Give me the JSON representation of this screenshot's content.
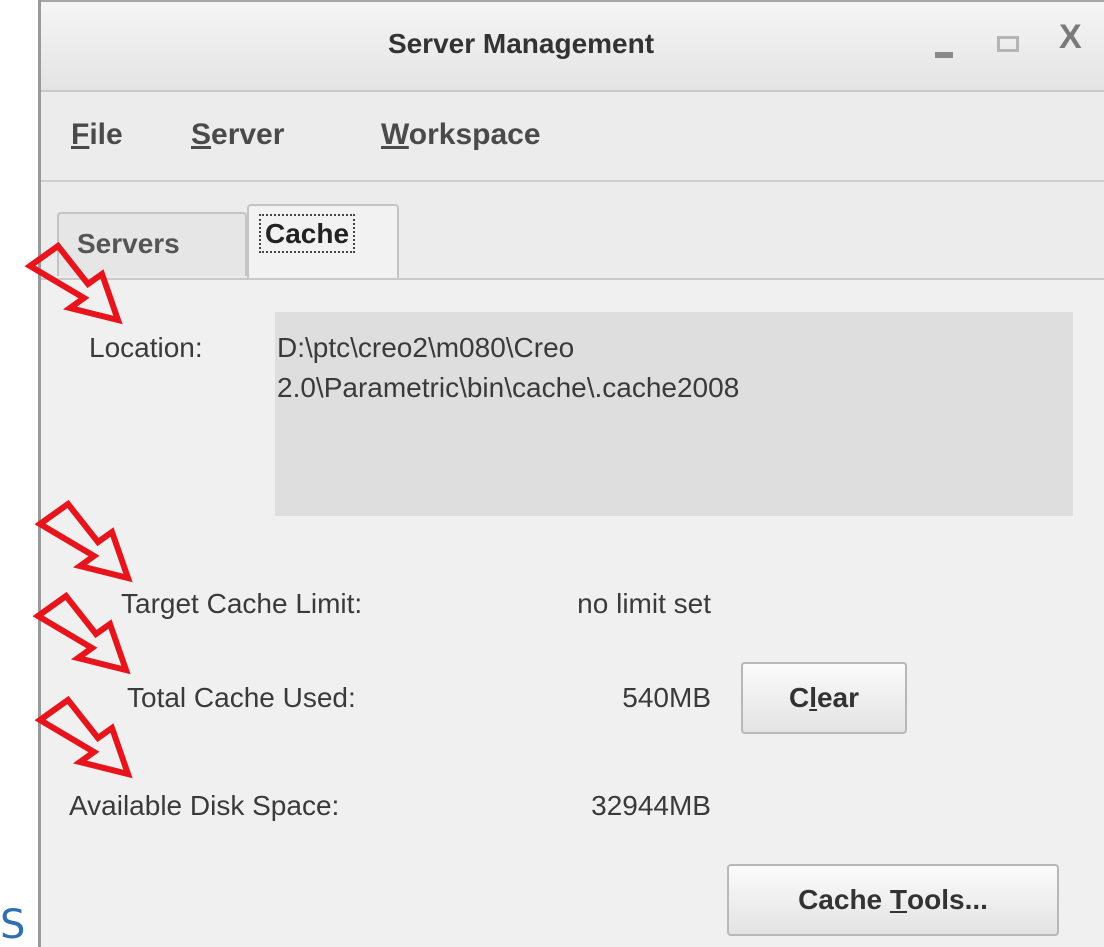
{
  "window": {
    "title": "Server Management",
    "controls": {
      "minimize_icon": "minimize-icon",
      "maximize_icon": "maximize-icon",
      "close": "X"
    }
  },
  "menubar": {
    "file": {
      "mnemonic": "F",
      "rest": "ile"
    },
    "server": {
      "mnemonic": "S",
      "rest": "erver"
    },
    "workspace": {
      "mnemonic": "W",
      "rest": "orkspace"
    }
  },
  "tabs": [
    {
      "label": "Servers",
      "active": false
    },
    {
      "label": "Cache",
      "active": true
    }
  ],
  "cache": {
    "location_label": "Location:",
    "location_value": "D:\\ptc\\creo2\\m080\\Creo\n2.0\\Parametric\\bin\\cache\\.cache2008",
    "target_limit_label": "Target Cache Limit:",
    "target_limit_value": "no limit set",
    "total_used_label": "Total Cache Used:",
    "total_used_value": "540MB",
    "disk_space_label": "Available Disk Space:",
    "disk_space_value": "32944MB",
    "clear_button": {
      "pre": "C",
      "mnemonic": "l",
      "post": "ear"
    },
    "tools_button": {
      "pre": "Cache ",
      "mnemonic": "T",
      "post": "ools..."
    }
  },
  "outside_fragment": "S",
  "colors": {
    "annotation_arrow": "#e8141c",
    "fragment_text": "#2f6fb3"
  }
}
